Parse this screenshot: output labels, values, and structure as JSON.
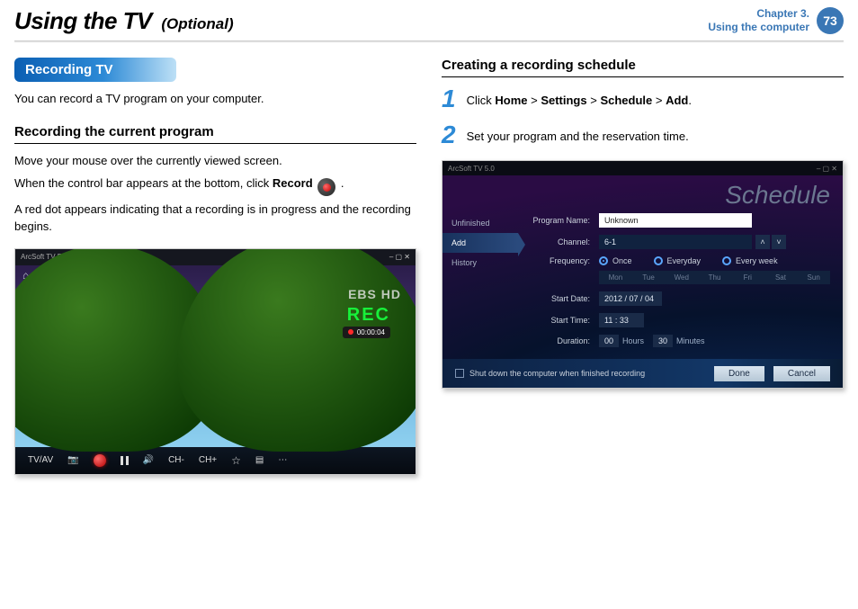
{
  "header": {
    "title": "Using the TV",
    "subtitle": "(Optional)",
    "chapter_line1": "Chapter 3.",
    "chapter_line2": "Using the computer",
    "page_number": "73"
  },
  "left": {
    "section_title": "Recording TV",
    "intro": "You can record a TV program on your computer.",
    "sub1": "Recording the current program",
    "p1": "Move your mouse over the currently viewed screen.",
    "p2a": "When the control bar appears at the bottom, click ",
    "p2b_bold": "Record",
    "p2c": " .",
    "p3": "A red dot appears indicating that a recording is in progress and the recording begins.",
    "tv": {
      "app_title": "ArcSoft TV 5.0",
      "watermark": "EBS HD",
      "rec": "REC",
      "rec_time": "00:00:04",
      "controls": {
        "source": "TV/AV",
        "ch_down": "CH-",
        "ch_up": "CH+"
      }
    }
  },
  "right": {
    "sub1": "Creating a recording schedule",
    "step1_pre": "Click ",
    "step1_b1": "Home",
    "step1_s1": " > ",
    "step1_b2": "Settings",
    "step1_s2": " > ",
    "step1_b3": "Schedule",
    "step1_s3": " > ",
    "step1_b4": "Add",
    "step1_post": ".",
    "step2": "Set your program and the reservation time.",
    "sched": {
      "app_title": "ArcSoft TV 5.0",
      "heading": "Schedule",
      "nav": {
        "unfinished": "Unfinished",
        "add": "Add",
        "history": "History"
      },
      "labels": {
        "program": "Program Name:",
        "channel": "Channel:",
        "frequency": "Frequency:",
        "start_date": "Start Date:",
        "start_time": "Start Time:",
        "duration": "Duration:"
      },
      "values": {
        "program": "Unknown",
        "channel": "6-1",
        "start_date": "2012 / 07 / 04",
        "start_time": "11 : 33",
        "dur_h": "00",
        "dur_m": "30"
      },
      "freq": {
        "once": "Once",
        "everyday": "Everyday",
        "everyweek": "Every week"
      },
      "days": {
        "mon": "Mon",
        "tue": "Tue",
        "wed": "Wed",
        "thu": "Thu",
        "fri": "Fri",
        "sat": "Sat",
        "sun": "Sun"
      },
      "units": {
        "hours": "Hours",
        "minutes": "Minutes"
      },
      "footer_chk": "Shut down the computer when finished recording",
      "done": "Done",
      "cancel": "Cancel"
    }
  }
}
